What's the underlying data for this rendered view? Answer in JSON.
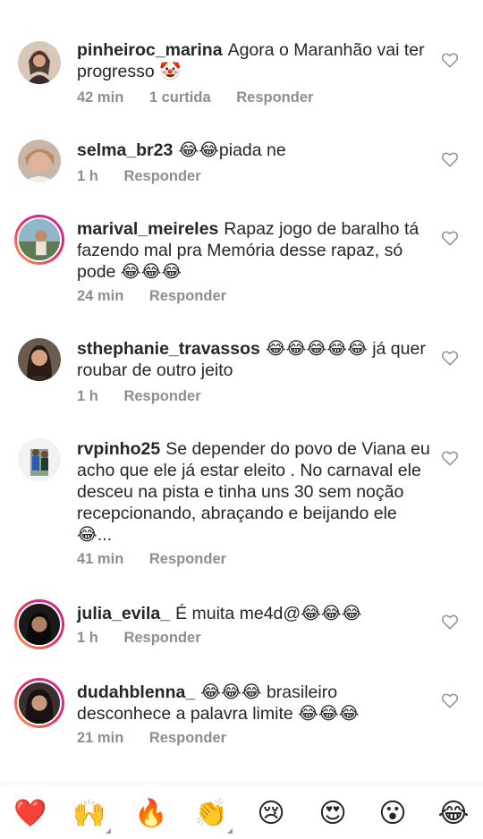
{
  "comments": [
    {
      "username": "pinheiroc_marina",
      "text": "Agora o Maranhão vai ter progresso 🤡",
      "time": "42 min",
      "likes": "1 curtida",
      "reply": "Responder"
    },
    {
      "username": "selma_br23",
      "text": "😂😂piada ne",
      "time": "1 h",
      "reply": "Responder"
    },
    {
      "username": "marival_meireles",
      "text": "Rapaz jogo de baralho tá fazendo mal pra Memória desse rapaz, só pode 😂😂😂",
      "time": "24 min",
      "reply": "Responder"
    },
    {
      "username": "sthephanie_travassos",
      "text": "😂😂😂😂😂 já quer roubar de outro jeito",
      "time": "1 h",
      "reply": "Responder"
    },
    {
      "username": "rvpinho25",
      "text": "Se depender do povo de Viana eu acho que ele já estar eleito . No carnaval ele desceu na pista e tinha uns 30 sem noção recepcionando, abraçando e beijando ele 😂...",
      "time": "41 min",
      "reply": "Responder"
    },
    {
      "username": "julia_evila_",
      "text": "É muita me4d@😂😂😂",
      "time": "1 h",
      "reply": "Responder"
    },
    {
      "username": "dudahblenna_",
      "text": "😂😂😂 brasileiro desconhece a palavra limite 😂😂😂",
      "time": "21 min",
      "reply": "Responder"
    }
  ],
  "reactions": [
    {
      "icon": "red-heart",
      "glyph": "❤️"
    },
    {
      "icon": "raising-hands",
      "glyph": "🙌"
    },
    {
      "icon": "fire",
      "glyph": "🔥"
    },
    {
      "icon": "clapping-hands",
      "glyph": "👏"
    },
    {
      "icon": "crying-face",
      "glyph": "😢"
    },
    {
      "icon": "heart-eyes",
      "glyph": "😍"
    },
    {
      "icon": "surprised-face",
      "glyph": "😮"
    },
    {
      "icon": "laughing-face",
      "glyph": "😂"
    }
  ]
}
